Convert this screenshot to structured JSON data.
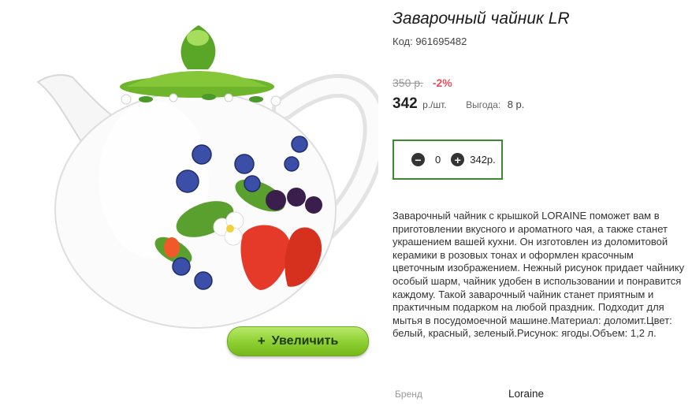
{
  "product": {
    "title": "Заварочный чайник LR",
    "code_text": "Код: 961695482",
    "old_price": "350 р.",
    "discount": "-2%",
    "price": "342",
    "price_unit": "р./шт.",
    "benefit_label": "Выгода:",
    "benefit_value": "8 р.",
    "description": "Заварочный чайник с крышкой LORAINE поможет вам в приготовлении вкусного и ароматного чая, а также станет украшением вашей кухни. Он изготовлен из доломитовой керамики в розовых тонах и оформлен красочным цветочным изображением. Нежный рисунок придает чайнику особый шарм, чайник удобен в использовании и понравится каждому. Такой заварочный чайник станет приятным и практичным подарком на любой праздник. Подходит для мытья в посудомоечной машине.Материал: доломит.Цвет: белый, красный, зеленый.Рисунок: ягоды.Объем: 1,2 л.",
    "brand_label": "Бренд",
    "brand_value": "Loraine"
  },
  "quantity": {
    "value": "0",
    "total": "342р.",
    "minus_icon": "minus-circle-icon",
    "plus_icon": "plus-circle-icon"
  },
  "image": {
    "zoom_label": "Увеличить",
    "zoom_icon": "plus-icon"
  },
  "colors": {
    "accent_green": "#8ccf2f",
    "qty_border": "#3a8a2e",
    "discount_red": "#e8505b"
  }
}
